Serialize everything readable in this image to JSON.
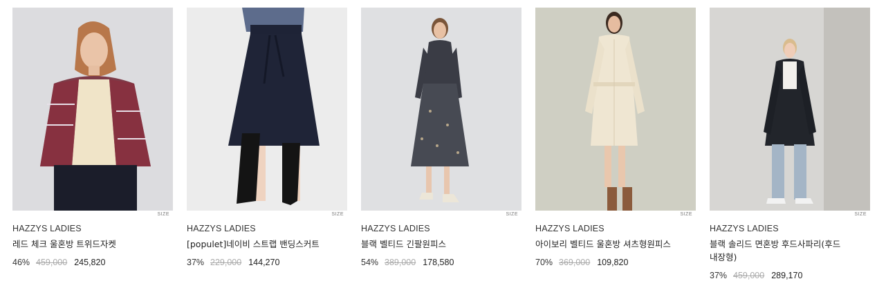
{
  "products": [
    {
      "brand": "HAZZYS LADIES",
      "name": "레드 체크 울혼방 트위드자켓",
      "discount": "46%",
      "original_price": "459,000",
      "sale_price": "245,820",
      "size_label": "SIZE"
    },
    {
      "brand": "HAZZYS LADIES",
      "name": "[populet]네이비 스트랩 밴딩스커트",
      "discount": "37%",
      "original_price": "229,000",
      "sale_price": "144,270",
      "size_label": "SIZE"
    },
    {
      "brand": "HAZZYS LADIES",
      "name": "블랙 벨티드 긴팔원피스",
      "discount": "54%",
      "original_price": "389,000",
      "sale_price": "178,580",
      "size_label": "SIZE"
    },
    {
      "brand": "HAZZYS LADIES",
      "name": "아이보리 벨티드 울혼방 셔츠형원피스",
      "discount": "70%",
      "original_price": "369,000",
      "sale_price": "109,820",
      "size_label": "SIZE"
    },
    {
      "brand": "HAZZYS LADIES",
      "name": "블랙 솔리드 면혼방 후드사파리(후드 내장형)",
      "discount": "37%",
      "original_price": "459,000",
      "sale_price": "289,170",
      "size_label": "SIZE"
    }
  ]
}
